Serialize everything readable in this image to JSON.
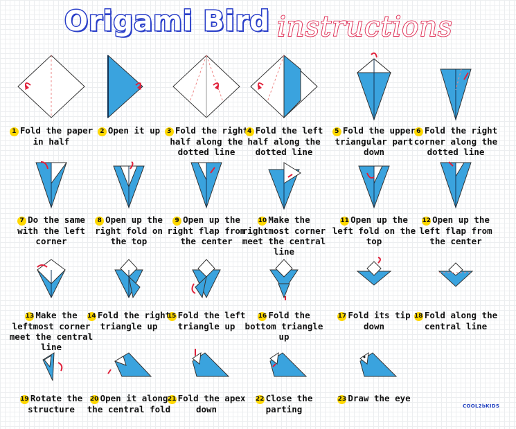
{
  "title": {
    "main": "Origami Bird",
    "sub": "instructions"
  },
  "colors": {
    "paper_blue": "#3aa3de",
    "paper_white": "#ffffff",
    "arrow": "#e0203a",
    "number_badge": "#ffd800",
    "title_blue": "#2a3fc9",
    "title_red": "#e0345a"
  },
  "steps": [
    {
      "num": "1",
      "label": "Fold the paper in half"
    },
    {
      "num": "2",
      "label": "Open it up"
    },
    {
      "num": "3",
      "label": "Fold the right half along the dotted line"
    },
    {
      "num": "4",
      "label": "Fold the left half along the dotted line"
    },
    {
      "num": "5",
      "label": "Fold the upper triangular part down"
    },
    {
      "num": "6",
      "label": "Fold the right corner along the dotted line"
    },
    {
      "num": "7",
      "label": "Do the same with the left corner"
    },
    {
      "num": "8",
      "label": "Open up the right fold on the top"
    },
    {
      "num": "9",
      "label": "Open up the right flap from the center"
    },
    {
      "num": "10",
      "label": "Make the rightmost corner meet the central line"
    },
    {
      "num": "11",
      "label": "Open up the left fold on the top"
    },
    {
      "num": "12",
      "label": "Open up the left flap from the center"
    },
    {
      "num": "13",
      "label": "Make the leftmost corner meet the central line"
    },
    {
      "num": "14",
      "label": "Fold the right triangle up"
    },
    {
      "num": "15",
      "label": "Fold the left triangle up"
    },
    {
      "num": "16",
      "label": "Fold the bottom triangle up"
    },
    {
      "num": "17",
      "label": "Fold its tip down"
    },
    {
      "num": "18",
      "label": "Fold along the central line"
    },
    {
      "num": "19",
      "label": "Rotate the structure"
    },
    {
      "num": "20",
      "label": "Open it along the central fold"
    },
    {
      "num": "21",
      "label": "Fold the apex down"
    },
    {
      "num": "22",
      "label": "Close the parting"
    },
    {
      "num": "23",
      "label": "Draw the eye"
    }
  ],
  "logo": {
    "text": "COOL2bKIDS",
    "icon": "cool2bkids-logo"
  }
}
